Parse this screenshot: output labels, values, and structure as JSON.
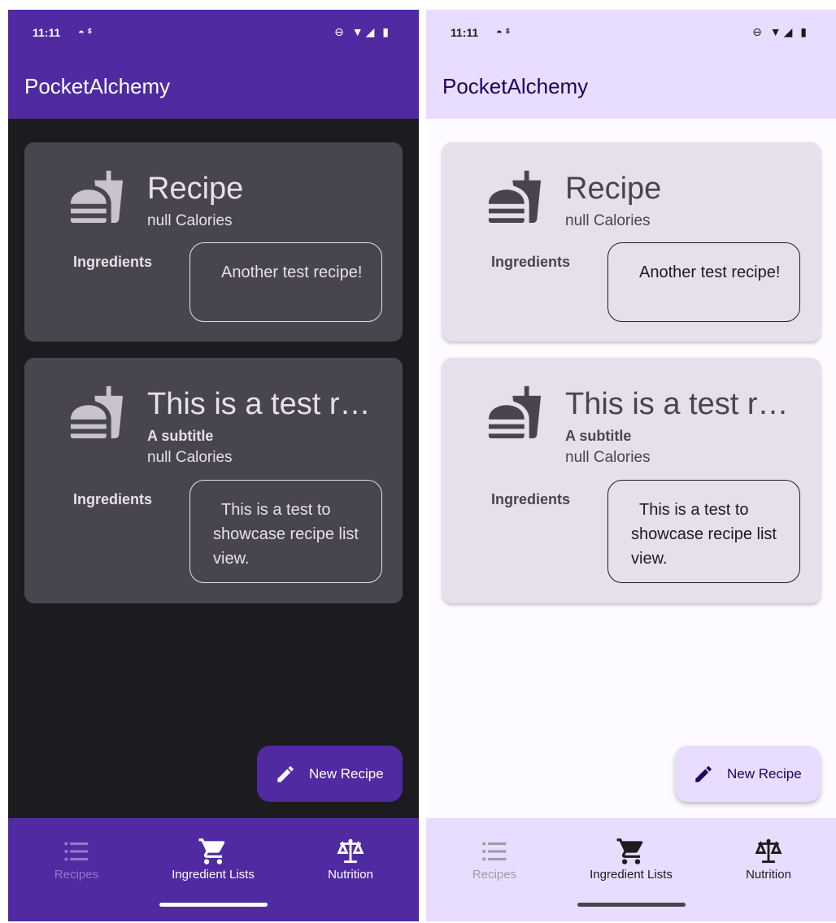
{
  "status_bar": {
    "time": "11:11",
    "left_icons": "◓  ᙚ",
    "right_icons": "⊖ ▼◢ ▮"
  },
  "app_bar": {
    "title": "PocketAlchemy"
  },
  "recipes": [
    {
      "icon": "fastfood-icon",
      "title": "Recipe",
      "subtitle": "",
      "calories": "null Calories",
      "ingredients_label": "Ingredients",
      "description": "Another test recipe!"
    },
    {
      "icon": "fastfood-icon",
      "title": "This is a test r…",
      "subtitle": "A subtitle",
      "calories": "null Calories",
      "ingredients_label": "Ingredients",
      "description": "This is a test to showcase recipe list view."
    }
  ],
  "fab": {
    "icon": "pencil-icon",
    "label": "New Recipe"
  },
  "bottom_nav": [
    {
      "icon": "list-icon",
      "label": "Recipes",
      "selected": false
    },
    {
      "icon": "cart-icon",
      "label": "Ingredient Lists",
      "selected": true
    },
    {
      "icon": "scale-icon",
      "label": "Nutrition",
      "selected": false
    }
  ],
  "themes": {
    "dark": {
      "bar": "#4f2aa1",
      "background": "#1c1b1f",
      "card": "#49454f"
    },
    "light": {
      "bar": "#e9ddff",
      "background": "#fdfbff",
      "card": "#e7e0ec"
    }
  }
}
